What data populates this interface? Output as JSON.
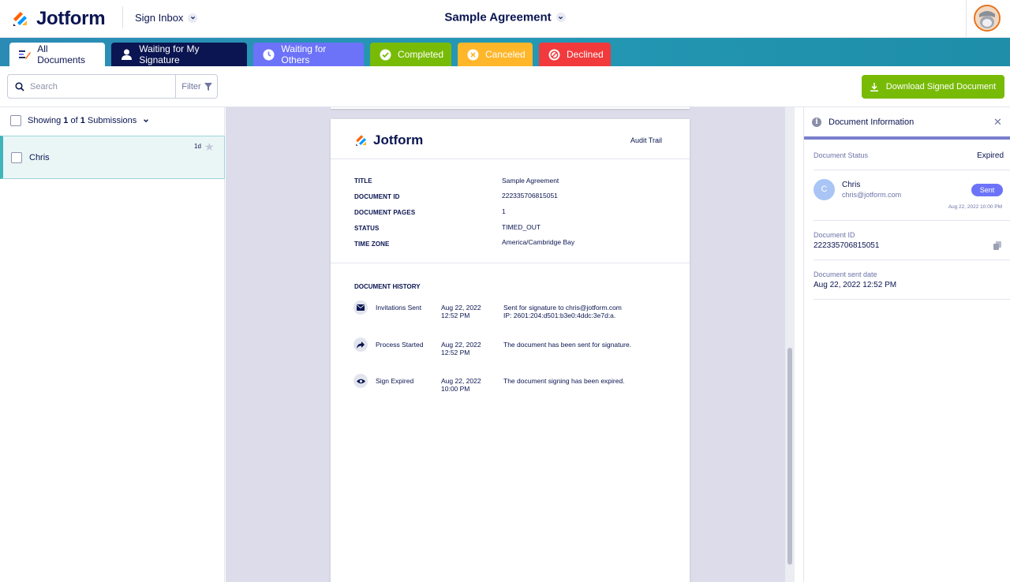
{
  "header": {
    "logo_text": "Jotform",
    "sign_inbox_label": "Sign Inbox",
    "document_title": "Sample Agreement"
  },
  "tabs": [
    {
      "label": "All Documents",
      "color": "#ffffff"
    },
    {
      "label": "Waiting for My Signature",
      "color": "#0a1551"
    },
    {
      "label": "Waiting for Others",
      "color": "#6c73f8"
    },
    {
      "label": "Completed",
      "color": "#78bb07"
    },
    {
      "label": "Canceled",
      "color": "#ffb629"
    },
    {
      "label": "Declined",
      "color": "#f23a3c"
    }
  ],
  "toolbar": {
    "search_placeholder": "Search",
    "filter_label": "Filter",
    "download_label": "Download Signed Document"
  },
  "submissions": {
    "showing_prefix": "Showing",
    "shown_count": "1",
    "of_text": "of",
    "total_count": "1",
    "suffix": "Submissions",
    "items": [
      {
        "name": "Chris",
        "age": "1d"
      }
    ]
  },
  "audit": {
    "logo_text": "Jotform",
    "audit_trail_label": "Audit Trail",
    "meta": [
      {
        "label": "TITLE",
        "value": "Sample Agreement"
      },
      {
        "label": "DOCUMENT ID",
        "value": "222335706815051"
      },
      {
        "label": "DOCUMENT PAGES",
        "value": "1"
      },
      {
        "label": "STATUS",
        "value": "TIMED_OUT"
      },
      {
        "label": "TIME ZONE",
        "value": "America/Cambridge Bay"
      }
    ],
    "history_title": "DOCUMENT HISTORY",
    "history": [
      {
        "icon": "envelope-icon",
        "event": "Invitations Sent",
        "date": "Aug 22, 2022",
        "time": "12:52 PM",
        "desc_line1": "Sent for signature to chris@jotform.com",
        "desc_line2": "IP: 2601:204:d501:b3e0:4ddc:3e7d:a."
      },
      {
        "icon": "share-arrow-icon",
        "event": "Process Started",
        "date": "Aug 22, 2022",
        "time": "12:52 PM",
        "desc_line1": "The document has been sent for signature.",
        "desc_line2": ""
      },
      {
        "icon": "eye-icon",
        "event": "Sign Expired",
        "date": "Aug 22, 2022",
        "time": "10:00 PM",
        "desc_line1": "The document signing has been expired.",
        "desc_line2": ""
      }
    ]
  },
  "info_panel": {
    "title": "Document Information",
    "status_label": "Document Status",
    "status_value": "Expired",
    "signer_initial": "C",
    "signer_name": "Chris",
    "signer_email": "chris@jotform.com",
    "signer_badge": "Sent",
    "signer_date": "Aug 22, 2022 10:00 PM",
    "doc_id_label": "Document ID",
    "doc_id_value": "222335706815051",
    "sent_date_label": "Document sent date",
    "sent_date_value": "Aug 22, 2022 12:52 PM"
  }
}
